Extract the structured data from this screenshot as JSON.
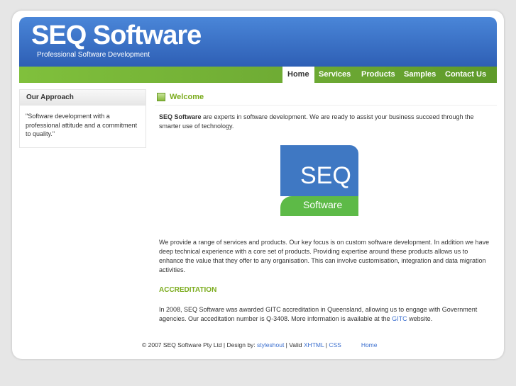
{
  "header": {
    "title": "SEQ Software",
    "slogan": "Professional Software Development"
  },
  "nav": [
    "Home",
    "Services",
    "Products",
    "Samples",
    "Contact Us"
  ],
  "sidebar": {
    "title": "Our Approach",
    "quote": "\"Software development with a professional attitude and a commitment to quality.\""
  },
  "main": {
    "heading": "Welcome",
    "intro_bold": "SEQ Software",
    "intro": " are experts in software development. We are ready to assist your business succeed through the smarter use of technology.",
    "logo": {
      "top": "SEQ",
      "bottom": "Software"
    },
    "para2": "We provide a range of services and products. Our key focus is on custom software development. In addition we have deep technical experience with a core set of products. Providing expertise around these products allows us to enhance the value that they offer to any organisation. This can involve customisation, integration and data migration activities.",
    "acc_heading": "ACCREDITATION",
    "para3": "In 2008, SEQ Software was awarded GITC accreditation in Queensland, allowing us to engage with Government agencies. Our acceditation number is Q-3408. More information is available at the ",
    "gitc": "GITC",
    "para3_end": " website."
  },
  "footer": {
    "copy": "© 2007 SEQ Software Pty Ltd | Design by: ",
    "styleshout": "styleshout",
    "valid": " | Valid ",
    "xhtml": "XHTML",
    "sep": " | ",
    "css": "CSS",
    "home": "Home"
  }
}
